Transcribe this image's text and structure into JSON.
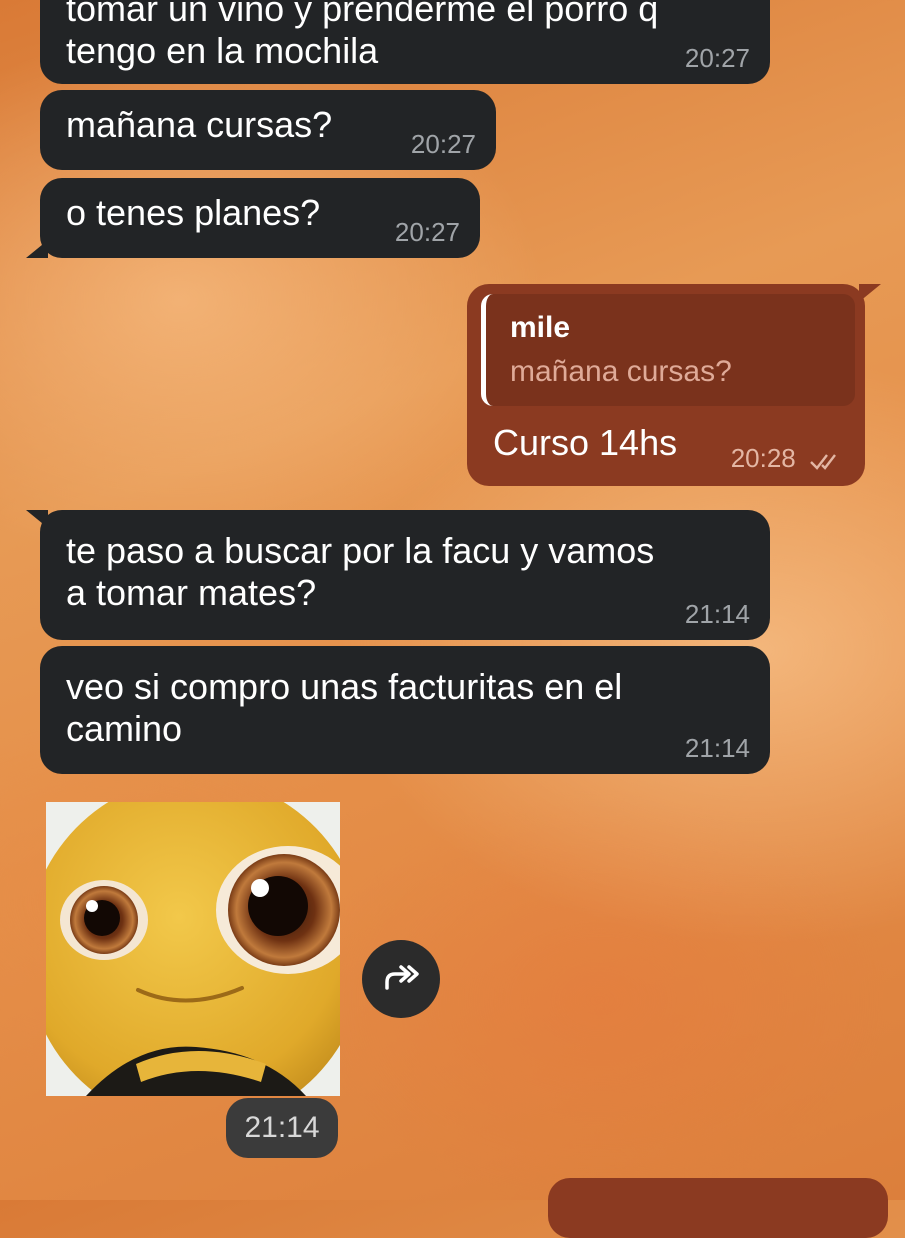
{
  "messages": [
    {
      "text": "tomar un vino y prenderme el porro q",
      "text2": "tengo en la mochila",
      "time": "20:27"
    },
    {
      "text": "mañana cursas?",
      "time": "20:27"
    },
    {
      "text": "o tenes planes?",
      "time": "20:27"
    },
    {
      "reply_name": "mile",
      "reply_text": "mañana cursas?",
      "text": "Curso 14hs",
      "time": "20:28",
      "status_icon": "double-check-icon"
    },
    {
      "text": "te paso a buscar por la facu y vamos",
      "text2": "a tomar mates?",
      "time": "21:14"
    },
    {
      "text": "veo si compro unas facturitas en el",
      "text2": "camino",
      "time": "21:14"
    }
  ],
  "sticker": {
    "time": "21:14",
    "icon": "forward-icon"
  },
  "colors": {
    "incoming": "#222426",
    "outgoing": "#8b3a21",
    "time_in": "#a0a4a8",
    "time_out": "#e3b6a4"
  }
}
